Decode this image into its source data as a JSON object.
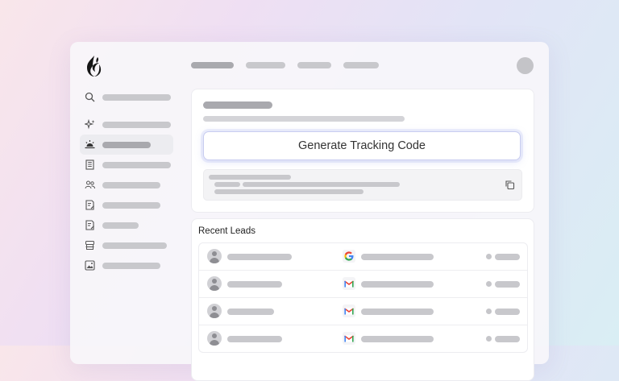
{
  "main": {
    "generate_label": "Generate Tracking Code"
  },
  "leads": {
    "title": "Recent Leads",
    "rows": [
      {
        "source_icon": "google-icon"
      },
      {
        "source_icon": "gmail-icon"
      },
      {
        "source_icon": "gmail-icon"
      },
      {
        "source_icon": "gmail-icon"
      }
    ]
  },
  "sidebar": {
    "icons": [
      "search-icon",
      "sparkle-icon",
      "sunrise-icon",
      "building-icon",
      "users-icon",
      "document-edit-icon",
      "document-edit-icon",
      "store-icon",
      "image-icon"
    ],
    "active_index": 2
  },
  "colors": {
    "accent_glow": "#c9cdf0",
    "placeholder": "#c8c8cc",
    "google_blue": "#4285F4",
    "google_red": "#EA4335",
    "google_yellow": "#FBBC05",
    "google_green": "#34A853"
  }
}
